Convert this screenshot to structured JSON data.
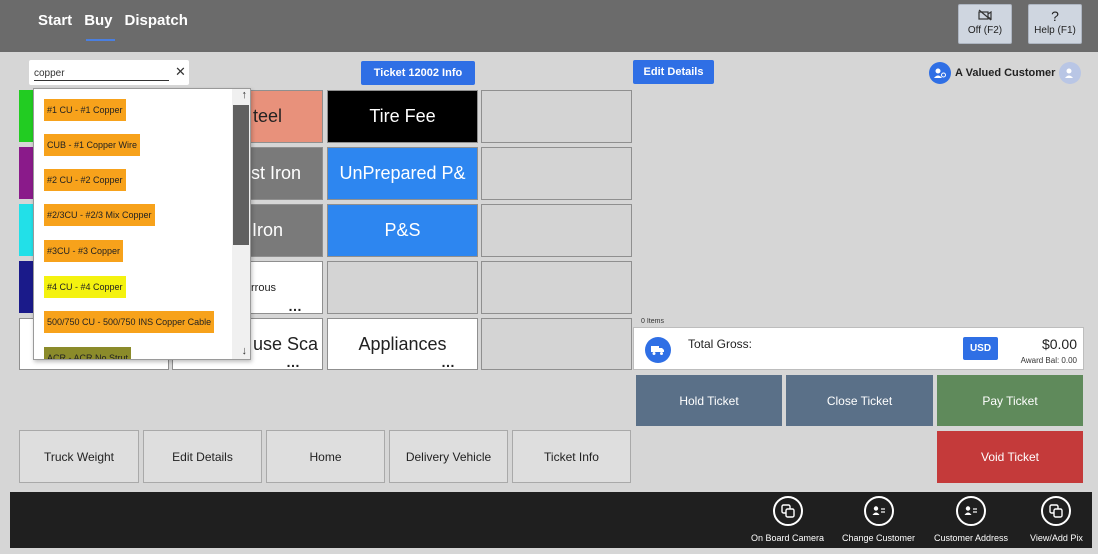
{
  "nav": {
    "tabs": [
      {
        "label": "Start"
      },
      {
        "label": "Buy"
      },
      {
        "label": "Dispatch"
      }
    ],
    "active": "Buy"
  },
  "header_buttons": {
    "off": {
      "label": "Off (F2)",
      "icon": "camera-off-icon"
    },
    "help": {
      "label": "Help (F1)",
      "icon": "question-icon",
      "glyph": "?"
    }
  },
  "search": {
    "value": "copper",
    "clear_glyph": "✕"
  },
  "ticket_info_label": "Ticket 12002 Info",
  "edit_details_top": "Edit Details",
  "customer": {
    "name": "A Valued Customer"
  },
  "tiles": [
    {
      "label": "teel"
    },
    {
      "label": "Tire Fee"
    },
    {
      "label": "ast Iron"
    },
    {
      "label": "UnPrepared P&"
    },
    {
      "label": "Iron"
    },
    {
      "label": "P&S"
    },
    {
      "label": "rrous"
    },
    {
      "label": "use Sca"
    },
    {
      "label": "Appliances"
    }
  ],
  "dropdown_items": [
    {
      "label": "#1 CU - #1 Copper"
    },
    {
      "label": "CUB - #1 Copper Wire"
    },
    {
      "label": "#2 CU - #2 Copper"
    },
    {
      "label": "#2/3CU - #2/3 Mix Copper"
    },
    {
      "label": "#3CU - #3 Copper"
    },
    {
      "label": "#4 CU - #4 Copper"
    },
    {
      "label": "500/750 CU - 500/750 INS Copper Cable"
    },
    {
      "label": "ACR - ACR No Strut"
    }
  ],
  "summary": {
    "items_count": "0 Items",
    "total_gross_label": "Total Gross:",
    "currency": "USD",
    "amount": "$0.00",
    "award_balance": "Award Bal: 0.00"
  },
  "actions": {
    "hold": "Hold Ticket",
    "close": "Close Ticket",
    "pay": "Pay Ticket",
    "void": "Void Ticket"
  },
  "bottom_buttons": [
    {
      "label": "Truck Weight"
    },
    {
      "label": "Edit Details"
    },
    {
      "label": "Home"
    },
    {
      "label": "Delivery Vehicle"
    },
    {
      "label": "Ticket Info"
    }
  ],
  "toolbar": [
    {
      "label": "On Board Camera",
      "icon": "camera-copy-icon"
    },
    {
      "label": "Change Customer",
      "icon": "person-list-icon"
    },
    {
      "label": "Customer Address",
      "icon": "person-list-icon"
    },
    {
      "label": "View/Add Pix",
      "icon": "copy-icon"
    }
  ],
  "colors": {
    "accent": "#2f6fe5",
    "header": "#6b6b6b",
    "dropdown_orange": "#f7a21b",
    "dropdown_yellow": "#f4f20f",
    "pay_green": "#5f8a5b",
    "void_red": "#c43a3a",
    "hold_slate": "#5a7088"
  }
}
